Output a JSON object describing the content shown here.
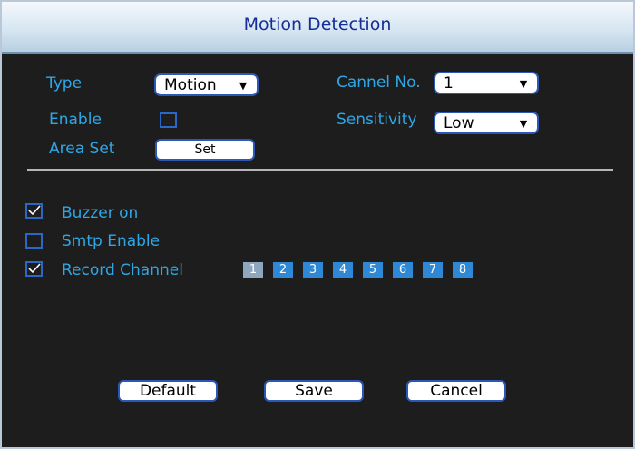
{
  "window": {
    "title": "Motion Detection"
  },
  "form": {
    "type_label": "Type",
    "type_value": "Motion",
    "channel_label": "Cannel No.",
    "channel_value": "1",
    "enable_label": "Enable",
    "enable_checked": false,
    "sensitivity_label": "Sensitivity",
    "sensitivity_value": "Low",
    "area_label": "Area Set",
    "area_button": "Set"
  },
  "options": {
    "buzzer_label": "Buzzer on",
    "buzzer_checked": true,
    "smtp_label": "Smtp Enable",
    "smtp_checked": false,
    "record_label": "Record Channel",
    "record_checked": true
  },
  "channels": [
    "1",
    "2",
    "3",
    "4",
    "5",
    "6",
    "7",
    "8"
  ],
  "buttons": {
    "default": "Default",
    "save": "Save",
    "cancel": "Cancel"
  },
  "colors": {
    "accent": "#2fa7e6",
    "channel": "#2f88d6",
    "channel_selected": "#8fa7be",
    "border": "#2b58b8"
  }
}
